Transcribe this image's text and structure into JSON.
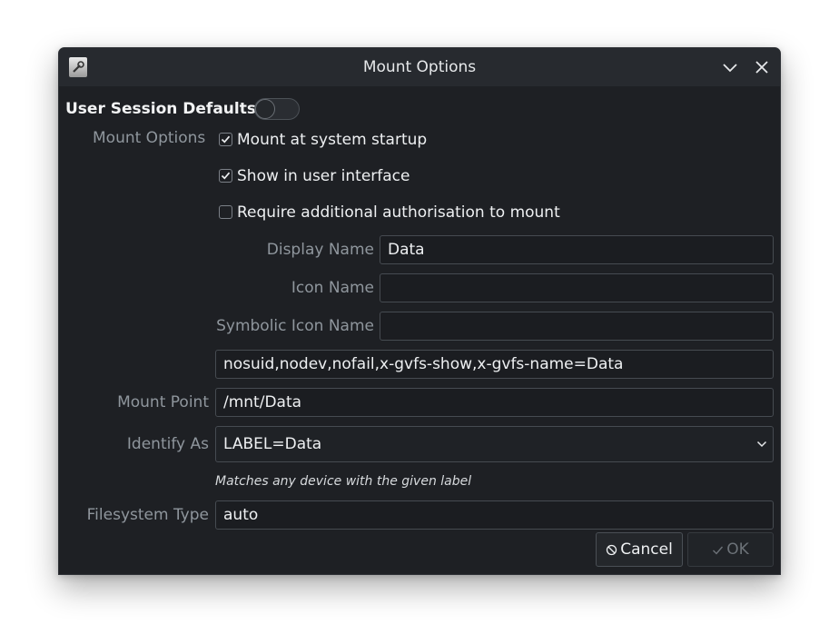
{
  "window": {
    "title": "Mount Options"
  },
  "defaults": {
    "label": "User Session Defaults",
    "enabled": false
  },
  "mount_options": {
    "section_label": "Mount Options",
    "checkboxes": [
      {
        "label": "Mount at system startup",
        "checked": true
      },
      {
        "label": "Show in user interface",
        "checked": true
      },
      {
        "label": "Require additional authorisation to mount",
        "checked": false
      }
    ]
  },
  "fields": {
    "display_name": {
      "label": "Display Name",
      "value": "Data"
    },
    "icon_name": {
      "label": "Icon Name",
      "value": ""
    },
    "symbolic_icon_name": {
      "label": "Symbolic Icon Name",
      "value": ""
    },
    "options_string": {
      "value": "nosuid,nodev,nofail,x-gvfs-show,x-gvfs-name=Data"
    },
    "mount_point": {
      "label": "Mount Point",
      "value": "/mnt/Data"
    },
    "identify_as": {
      "label": "Identify As",
      "value": "LABEL=Data",
      "hint": "Matches any device with the given label"
    },
    "filesystem_type": {
      "label": "Filesystem Type",
      "value": "auto"
    }
  },
  "buttons": {
    "cancel": "Cancel",
    "ok": "OK"
  }
}
